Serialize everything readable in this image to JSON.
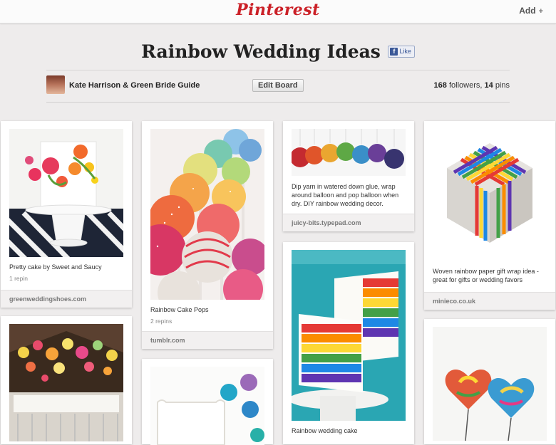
{
  "header": {
    "logo": "Pinterest",
    "add_label": "Add",
    "add_icon": "+"
  },
  "board": {
    "title": "Rainbow Wedding Ideas",
    "like_label": "Like",
    "owners": "Kate Harrison & Green Bride Guide",
    "edit_label": "Edit Board",
    "followers_count": "168",
    "followers_label": "followers,",
    "pins_count": "14",
    "pins_label": "pins"
  },
  "pins": [
    {
      "description": "Pretty cake by Sweet and Saucy",
      "repins": "1 repin",
      "source": "greenweddingshoes.com"
    },
    {
      "description": "Rainbow Cake Pops",
      "repins": "2 repins",
      "source": "tumblr.com"
    },
    {
      "description": "Dip yarn in watered down glue, wrap around balloon and pop balloon when dry. DIY rainbow wedding decor.",
      "source": "juicy-bits.typepad.com"
    },
    {
      "description": "Woven rainbow paper gift wrap idea - great for gifts or wedding favors",
      "source": "minieco.co.uk"
    },
    {
      "description": "Rainbow wedding cake"
    }
  ],
  "colors": {
    "brand": "#cb2027",
    "background": "#eeecec",
    "facebook": "#3b5998"
  }
}
